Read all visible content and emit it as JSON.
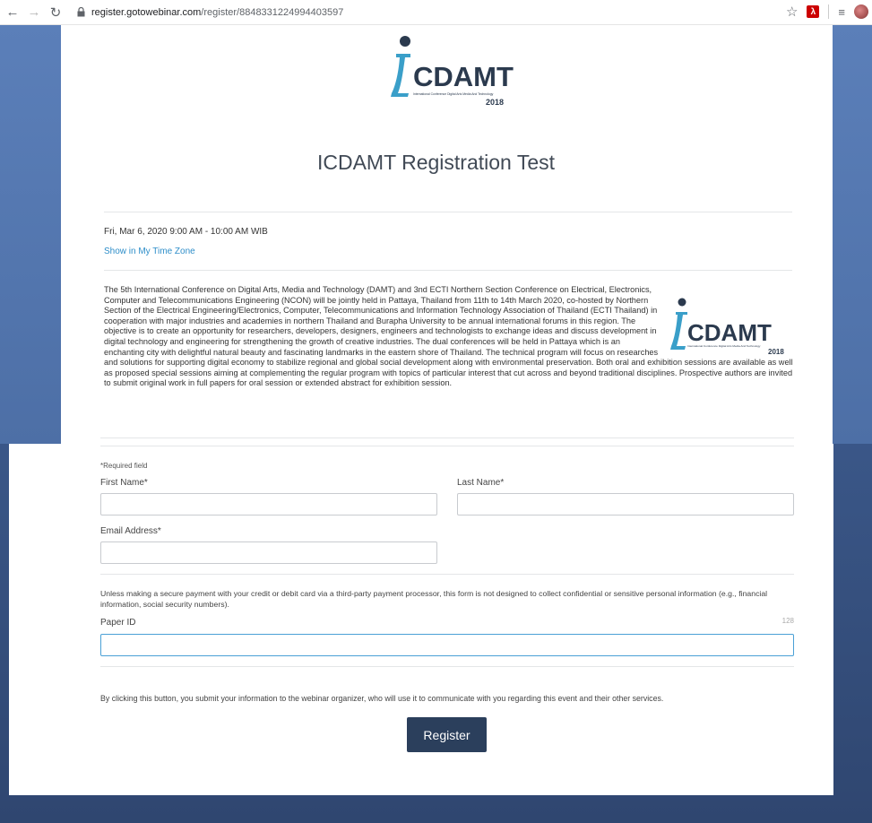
{
  "browser": {
    "url_host": "register.gotowebinar.com",
    "url_path": "/register/8848331224994403597"
  },
  "logo": {
    "text": "CDAMT",
    "tagline": "International Conference Digital Arts Media And Technology",
    "year": "2018"
  },
  "event": {
    "title": "ICDAMT Registration Test",
    "datetime": "Fri, Mar 6, 2020 9:00 AM - 10:00 AM WIB",
    "timezone_link": "Show in My Time Zone",
    "description": "The 5th International Conference on Digital Arts, Media and Technology (DAMT) and 3nd ECTI Northern Section Conference on Electrical, Electronics, Computer and Telecommunications Engineering (NCON) will be jointly held in Pattaya, Thailand from 11th to 14th March 2020, co-hosted by Northern Section of the Electrical Engineering/Electronics, Computer, Telecommunications and Information Technology Association of Thailand (ECTI Thailand) in cooperation with major industries and academies in northern Thailand and Burapha University to be annual international forums in this region. The objective is to create an opportunity for researchers, developers, designers, engineers and technologists to exchange ideas and discuss development in digital technology and engineering for strengthening the growth of creative industries. The dual conferences will be held in Pattaya which is an enchanting city with delightful natural beauty and fascinating landmarks in the eastern shore of Thailand. The technical program will focus on researches and solutions for supporting digital economy to stabilize regional and global social development along with environmental preservation. Both oral and exhibition sessions are available as well as proposed special sessions aiming at complementing the regular program with topics of particular interest that cut across and beyond traditional disciplines. Prospective authors are invited to submit original work in full papers for oral session or extended abstract for exhibition session."
  },
  "form": {
    "required_note": "*Required field",
    "first_name_label": "First Name*",
    "first_name_value": "",
    "last_name_label": "Last Name*",
    "last_name_value": "",
    "email_label": "Email Address*",
    "email_value": "",
    "notice": "Unless making a secure payment with your credit or debit card via a third-party payment processor, this form is not designed to collect confidential or sensitive personal information (e.g., financial information, social security numbers).",
    "paper_id_label": "Paper ID",
    "paper_id_value": "",
    "paper_id_counter": "128",
    "consent": "By clicking this button, you submit your information to the webinar organizer, who will use it to communicate with you regarding this event and their other services.",
    "register_label": "Register"
  },
  "colors": {
    "logo_blue": "#3a9fc9",
    "logo_dark": "#2b3a4e",
    "button_bg": "#2b3f5c",
    "link": "#2e8ec9",
    "background": "#4a6ba3"
  }
}
